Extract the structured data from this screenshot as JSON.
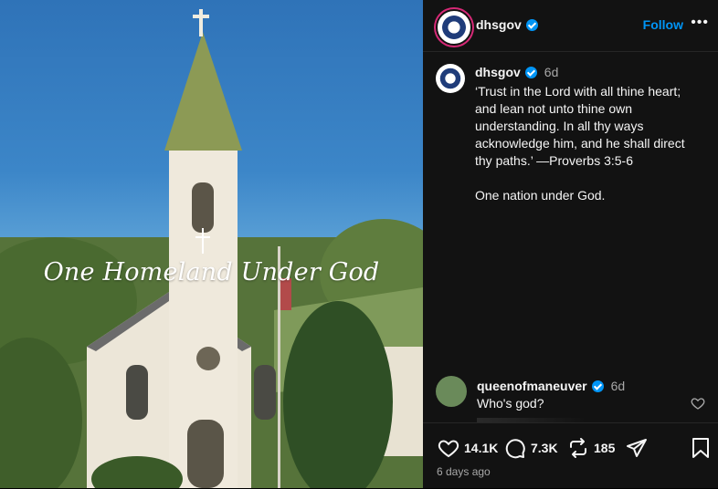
{
  "post": {
    "overlay_text": "One Homeland Under God"
  },
  "header": {
    "username": "dhsgov",
    "follow_label": "Follow",
    "more_label": "•••"
  },
  "caption": {
    "username": "dhsgov",
    "time": "6d",
    "text": "‘Trust in the Lord with all thine heart; and lean not unto thine own understanding. In all thy ways acknowledge him, and he shall direct thy paths.’ —Proverbs 3:5-6\n\nOne nation under God."
  },
  "comment": {
    "username": "queenofmaneuver",
    "time": "6d",
    "text": "Who's god?"
  },
  "actions": {
    "likes": "14.1K",
    "comments": "7.3K",
    "reposts": "185",
    "posted": "6 days ago"
  },
  "colors": {
    "accent": "#0095f6",
    "panel_bg": "#121212"
  }
}
